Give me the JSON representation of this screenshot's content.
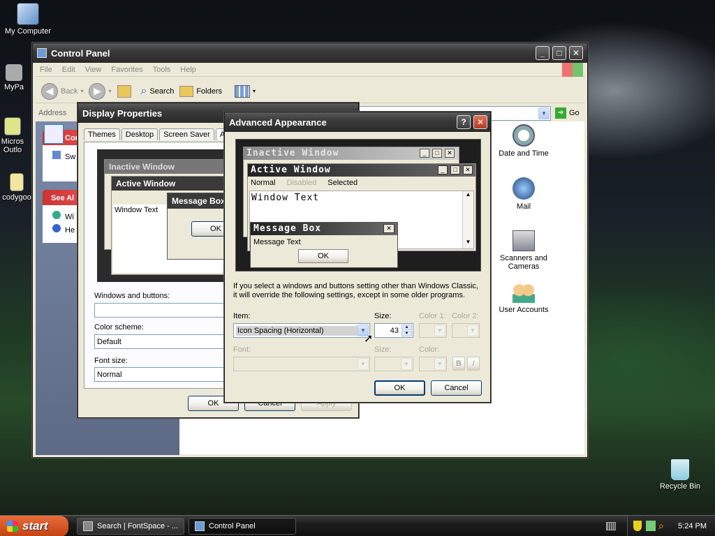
{
  "desktop": {
    "icons": [
      {
        "label": "My Computer"
      },
      {
        "label": "MyPa"
      },
      {
        "label": "Micros"
      },
      {
        "label": "Outlo"
      },
      {
        "label": "codygoo"
      },
      {
        "label": "Recycle Bin"
      }
    ]
  },
  "control_panel": {
    "title": "Control Panel",
    "menu": [
      "File",
      "Edit",
      "View",
      "Favorites",
      "Tools",
      "Help"
    ],
    "toolbar": {
      "back": "Back",
      "search": "Search",
      "folders": "Folders"
    },
    "address_label": "Address",
    "go_label": "Go",
    "left_panel": {
      "control_title": "Con",
      "switch_link": "Sw",
      "see_also_title": "See Al",
      "link1": "Wi",
      "link2": "He"
    },
    "items": [
      {
        "label": "Date and Time"
      },
      {
        "label": "Mail"
      },
      {
        "label": "Scanners and Cameras"
      },
      {
        "label": "User Accounts"
      }
    ]
  },
  "display_properties": {
    "title": "Display Properties",
    "tabs": [
      "Themes",
      "Desktop",
      "Screen Saver",
      "Ap"
    ],
    "preview": {
      "inactive": "Inactive Window",
      "active": "Active Window",
      "window_text": "Window Text",
      "message_box": "Message Box",
      "ok": "OK"
    },
    "windows_buttons_label": "Windows and buttons:",
    "windows_buttons_value": "",
    "color_scheme_label": "Color scheme:",
    "color_scheme_value": "Default",
    "font_size_label": "Font size:",
    "font_size_value": "Normal",
    "ok": "OK",
    "cancel": "Cancel",
    "apply": "Apply"
  },
  "advanced_appearance": {
    "title": "Advanced Appearance",
    "preview": {
      "inactive": "Inactive Window",
      "active": "Active Window",
      "menu_normal": "Normal",
      "menu_disabled": "Disabled",
      "menu_selected": "Selected",
      "window_text": "Window Text",
      "message_box": "Message Box",
      "message_text": "Message Text",
      "ok": "OK"
    },
    "info_text_line1": "If you select a windows and buttons setting other than Windows Classic,",
    "info_text_line2": "it will override the following settings, except in some older programs.",
    "item_label": "Item:",
    "item_value": "Icon Spacing (Horizontal)",
    "size_label": "Size:",
    "size_value": "43",
    "color1_label": "Color 1:",
    "color2_label": "Color 2:",
    "font_label": "Font:",
    "font_size_label": "Size:",
    "font_color_label": "Color:",
    "bold": "B",
    "italic": "I",
    "ok": "OK",
    "cancel": "Cancel"
  },
  "taskbar": {
    "start": "start",
    "tasks": [
      {
        "label": "Search | FontSpace - ..."
      },
      {
        "label": "Control Panel"
      }
    ],
    "clock": "5:24 PM"
  }
}
